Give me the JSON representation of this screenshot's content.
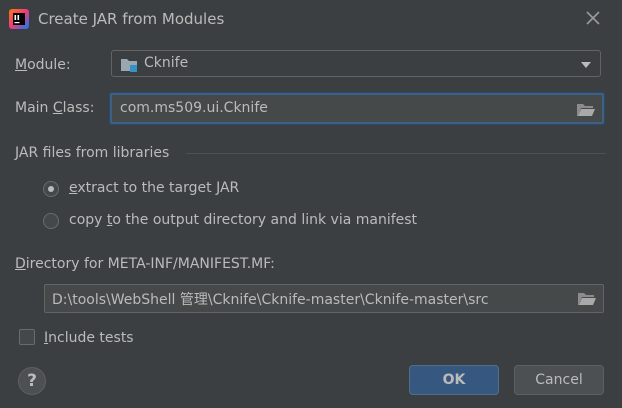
{
  "dialog": {
    "title": "Create JAR from Modules",
    "module_label_pre": "",
    "module_label_key": "M",
    "module_label_post": "odule:",
    "module_value": "Cknife",
    "main_class_label_pre": "Main ",
    "main_class_label_key": "C",
    "main_class_label_post": "lass:",
    "main_class_value": "com.ms509.ui.Cknife",
    "libraries_section": "JAR files from libraries",
    "radio_extract_key": "e",
    "radio_extract_rest": "xtract to the target JAR",
    "radio_copy_pre": "copy ",
    "radio_copy_key": "t",
    "radio_copy_rest": "o the output directory and link via manifest",
    "manifest_label_key": "D",
    "manifest_label_rest": "irectory for META-INF/MANIFEST.MF:",
    "manifest_dir_value": "D:\\tools\\WebShell 管理\\Cknife\\Cknife-master\\Cknife-master\\src",
    "include_tests_key": "I",
    "include_tests_rest": "nclude tests",
    "help_symbol": "?",
    "ok_label": "OK",
    "cancel_label": "Cancel"
  },
  "state": {
    "selected_library_option": "extract",
    "include_tests_checked": false
  },
  "icons": {
    "app": "intellij-idea-icon",
    "close": "close-icon",
    "module": "module-folder-icon",
    "browse": "folder-open-icon",
    "dropdown": "chevron-down-icon"
  },
  "colors": {
    "background": "#3c3f41",
    "text": "#bbbbbb",
    "field_bg": "#45494a",
    "focus_border": "#3d6185",
    "ok_button": "#365880",
    "module_icon_blue": "#3592c4"
  }
}
